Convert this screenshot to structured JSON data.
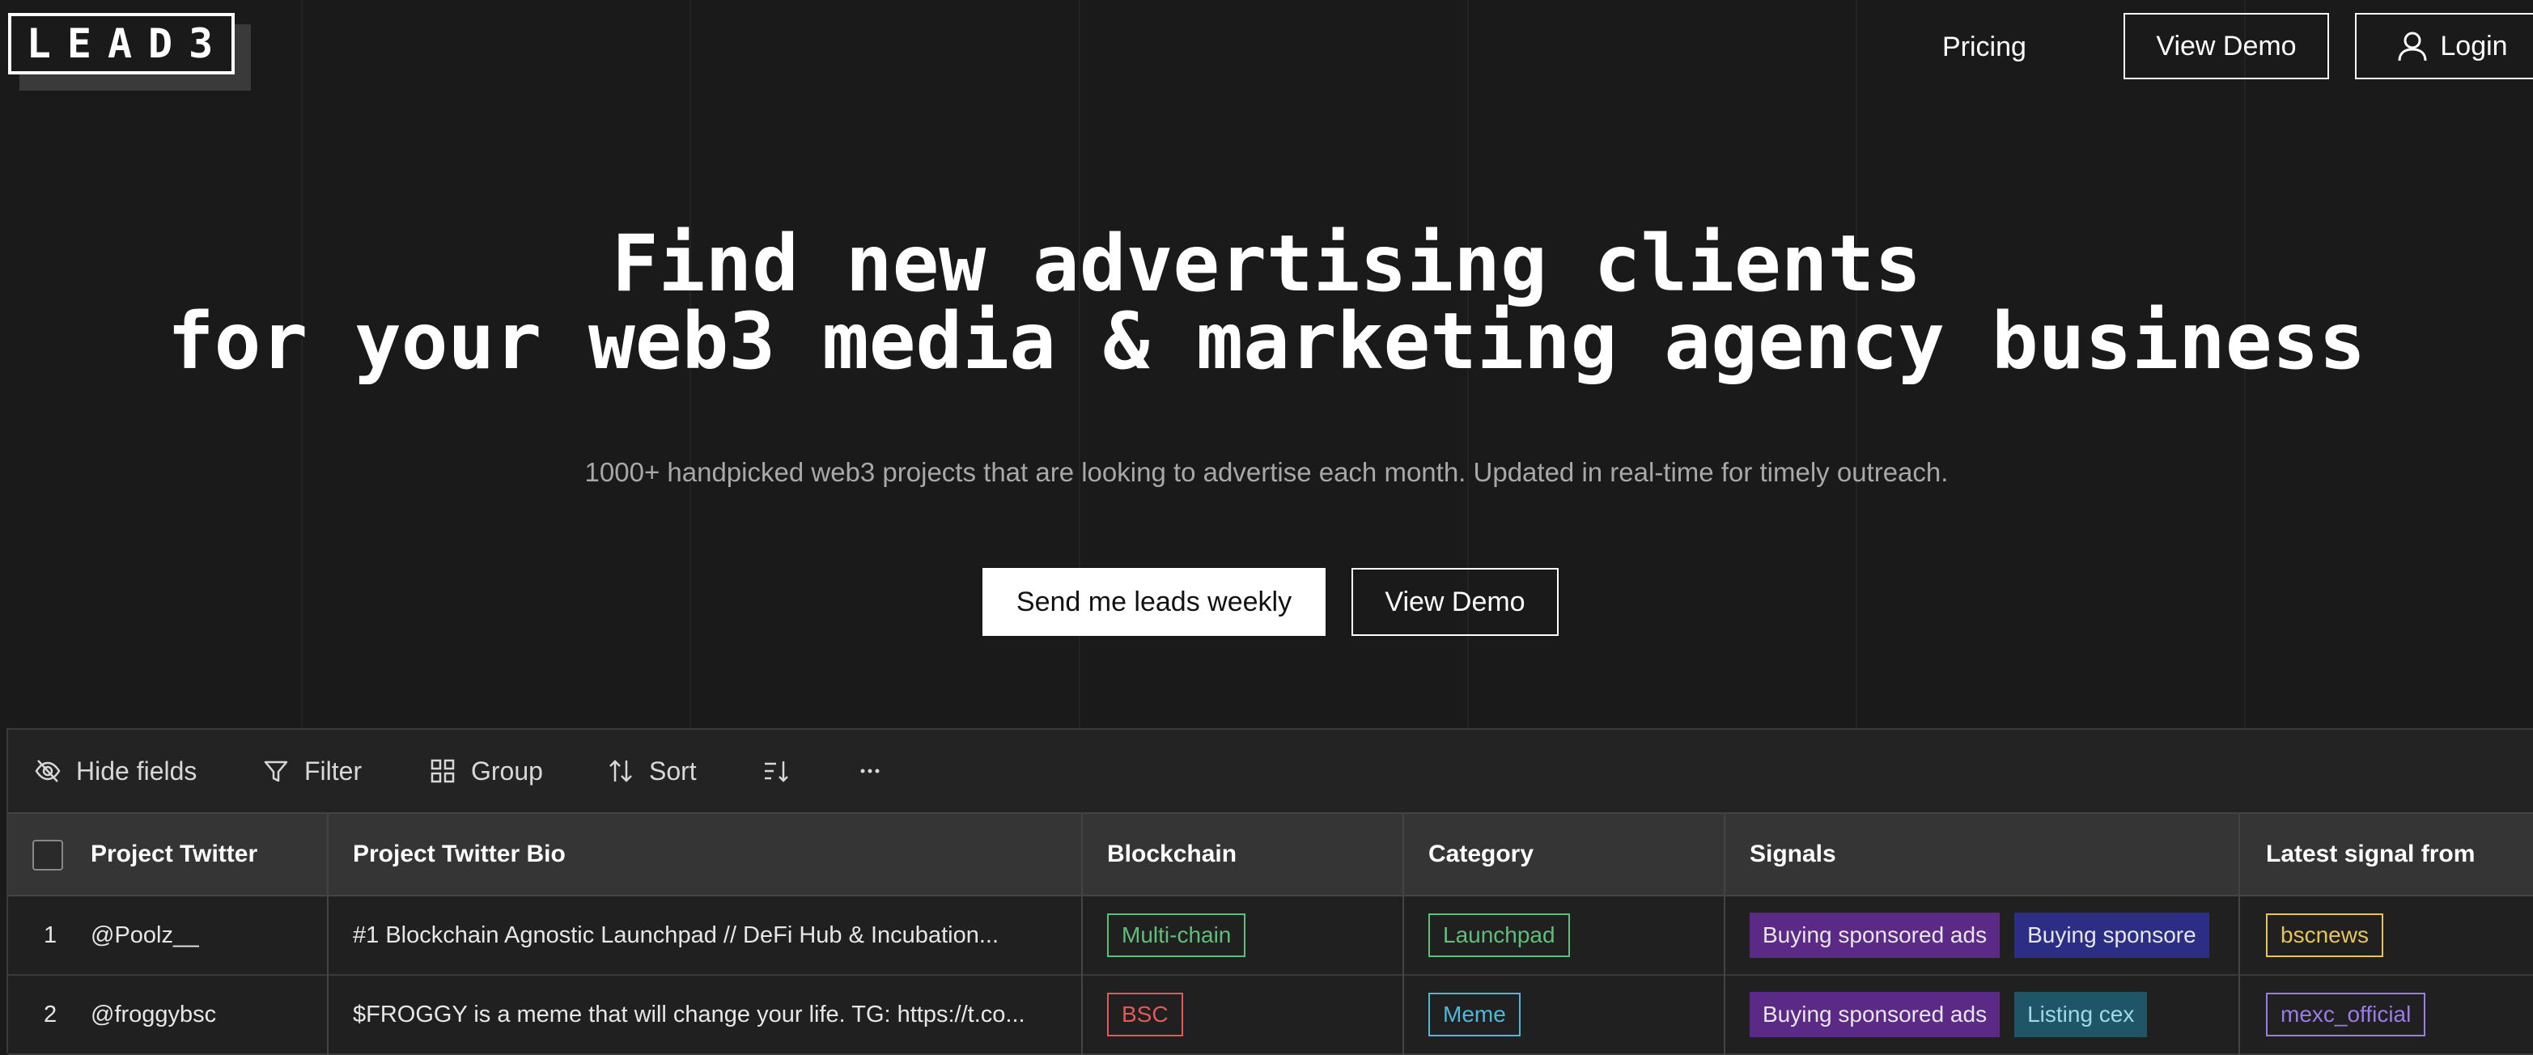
{
  "brand": {
    "logo_text": "LEAD3"
  },
  "nav": {
    "pricing_label": "Pricing",
    "view_demo_label": "View Demo",
    "login_label": "Login"
  },
  "hero": {
    "title_line1": "Find new advertising clients",
    "title_line2": "for your web3 media & marketing agency business",
    "subtitle": "1000+ handpicked web3 projects that are looking to advertise each month. Updated in real-time for timely outreach.",
    "primary_cta": "Send me leads weekly",
    "secondary_cta": "View Demo"
  },
  "toolbar": {
    "hide_fields": "Hide fields",
    "filter": "Filter",
    "group": "Group",
    "sort": "Sort",
    "row_height_icon": "row-height-icon",
    "more_icon": "more-icon"
  },
  "table": {
    "columns": [
      "Project Twitter",
      "Project Twitter Bio",
      "Blockchain",
      "Category",
      "Signals",
      "Latest signal from"
    ],
    "rows": [
      {
        "index": "1",
        "twitter": "@Poolz__",
        "bio": "#1 Blockchain Agnostic Launchpad // DeFi Hub & Incubation...",
        "blockchain": "Multi-chain",
        "category": "Launchpad",
        "signals": [
          "Buying sponsored ads",
          "Buying sponsore"
        ],
        "latest": "bscnews"
      },
      {
        "index": "2",
        "twitter": "@froggybsc",
        "bio": "$FROGGY is a meme that will change your life. TG: https://t.co...",
        "blockchain": "BSC",
        "category": "Meme",
        "signals": [
          "Buying sponsored ads",
          "Listing cex"
        ],
        "latest": "mexc_official"
      }
    ]
  },
  "colors": {
    "background": "#1a1a1a",
    "tag_green": "#5fbf7a",
    "tag_red": "#e05a5a",
    "tag_cyan": "#4fb8d8",
    "tag_yellow": "#e6c45a",
    "tag_purple": "#9b7be8",
    "pill_purple": "#5b2a86",
    "pill_indigo": "#2c2e85",
    "pill_teal": "#1f5566"
  }
}
